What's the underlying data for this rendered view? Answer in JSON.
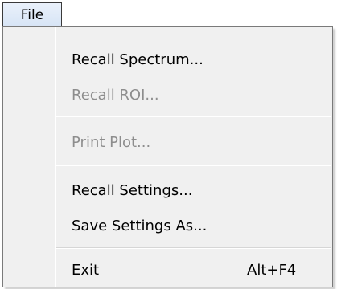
{
  "menubar": {
    "file_label": "File"
  },
  "menu": {
    "items": [
      {
        "label": "Recall Spectrum...",
        "enabled": true
      },
      {
        "label": "Recall ROI...",
        "enabled": false
      },
      {
        "label": "Print Plot...",
        "enabled": false
      },
      {
        "label": "Recall Settings...",
        "enabled": true
      },
      {
        "label": "Save Settings As...",
        "enabled": true
      },
      {
        "label": "Exit",
        "shortcut": "Alt+F4",
        "enabled": true
      }
    ]
  }
}
